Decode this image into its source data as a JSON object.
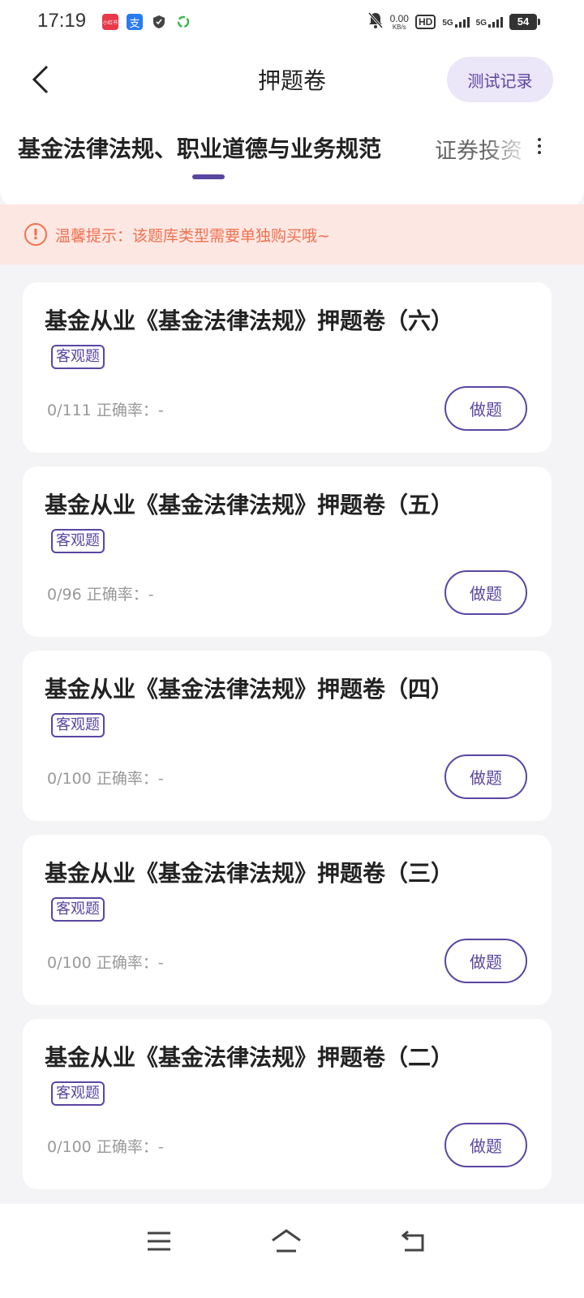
{
  "status_bar": {
    "time": "17:19",
    "apps": [
      {
        "icon": "app-red-icon",
        "color": "#e8384a",
        "label": "小红书"
      },
      {
        "icon": "alipay-icon",
        "color": "#2a7bf2",
        "label": "支"
      },
      {
        "icon": "shield-icon",
        "color": "#444444",
        "label": ""
      },
      {
        "icon": "recycle-icon",
        "color": "#3bb54a",
        "label": ""
      }
    ],
    "net_speed_value": "0.00",
    "net_speed_unit": "KB/s",
    "hd_label": "HD",
    "signal_1": "5G",
    "signal_2": "5G",
    "battery": "54"
  },
  "header": {
    "title": "押题卷",
    "record_button": "测试记录"
  },
  "tabs": {
    "items": [
      {
        "label": "基金法律法规、职业道德与业务规范",
        "active": true
      },
      {
        "label": "证券投资",
        "active": false
      }
    ],
    "accent_color": "#5a46a2"
  },
  "notice": {
    "icon": "!",
    "text": "温馨提示：该题库类型需要单独购买哦~",
    "color": "#f0714f"
  },
  "papers": [
    {
      "title": "基金从业《基金法律法规》押题卷（六）",
      "tag": "客观题",
      "progress": "0/111",
      "accuracy_label": "正确率：-",
      "button": "做题"
    },
    {
      "title": "基金从业《基金法律法规》押题卷（五）",
      "tag": "客观题",
      "progress": "0/96",
      "accuracy_label": "正确率：-",
      "button": "做题"
    },
    {
      "title": "基金从业《基金法律法规》押题卷（四）",
      "tag": "客观题",
      "progress": "0/100",
      "accuracy_label": "正确率：-",
      "button": "做题"
    },
    {
      "title": "基金从业《基金法律法规》押题卷（三）",
      "tag": "客观题",
      "progress": "0/100",
      "accuracy_label": "正确率：-",
      "button": "做题"
    },
    {
      "title": "基金从业《基金法律法规》押题卷（二）",
      "tag": "客观题",
      "progress": "0/100",
      "accuracy_label": "正确率：-",
      "button": "做题"
    }
  ],
  "nav_bar": {
    "items": [
      "menu-icon",
      "home-icon",
      "back-icon"
    ]
  }
}
